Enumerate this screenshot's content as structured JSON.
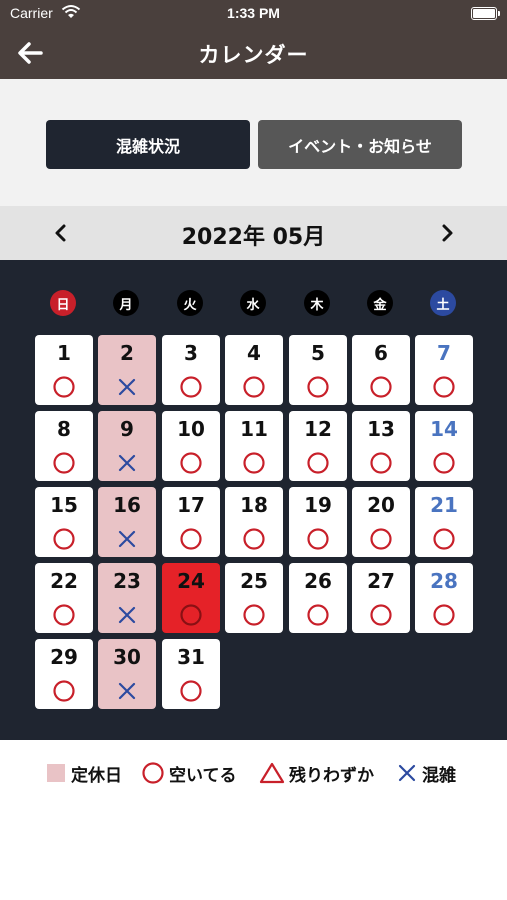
{
  "status": {
    "carrier": "Carrier",
    "time": "1:33 PM"
  },
  "nav": {
    "title": "カレンダー",
    "back_icon": "arrow-left-icon"
  },
  "tabs": {
    "congestion": "混雑状況",
    "events": "イベント・お知らせ"
  },
  "month": {
    "label": "2022年 05月",
    "prev_icon": "chevron-left-icon",
    "next_icon": "chevron-right-icon"
  },
  "weekdays": [
    "日",
    "月",
    "火",
    "水",
    "木",
    "金",
    "土"
  ],
  "calendar": {
    "first_weekday": 0,
    "days": [
      {
        "n": "1",
        "s": "o"
      },
      {
        "n": "2",
        "s": "x",
        "closed": true
      },
      {
        "n": "3",
        "s": "o"
      },
      {
        "n": "4",
        "s": "o"
      },
      {
        "n": "5",
        "s": "o"
      },
      {
        "n": "6",
        "s": "o"
      },
      {
        "n": "7",
        "s": "o"
      },
      {
        "n": "8",
        "s": "o"
      },
      {
        "n": "9",
        "s": "x",
        "closed": true
      },
      {
        "n": "10",
        "s": "o"
      },
      {
        "n": "11",
        "s": "o"
      },
      {
        "n": "12",
        "s": "o"
      },
      {
        "n": "13",
        "s": "o"
      },
      {
        "n": "14",
        "s": "o"
      },
      {
        "n": "15",
        "s": "o"
      },
      {
        "n": "16",
        "s": "x",
        "closed": true
      },
      {
        "n": "17",
        "s": "o"
      },
      {
        "n": "18",
        "s": "o"
      },
      {
        "n": "19",
        "s": "o"
      },
      {
        "n": "20",
        "s": "o"
      },
      {
        "n": "21",
        "s": "o"
      },
      {
        "n": "22",
        "s": "o"
      },
      {
        "n": "23",
        "s": "x",
        "closed": true
      },
      {
        "n": "24",
        "s": "o",
        "today": true
      },
      {
        "n": "25",
        "s": "o"
      },
      {
        "n": "26",
        "s": "o"
      },
      {
        "n": "27",
        "s": "o"
      },
      {
        "n": "28",
        "s": "o"
      },
      {
        "n": "29",
        "s": "o"
      },
      {
        "n": "30",
        "s": "x",
        "closed": true
      },
      {
        "n": "31",
        "s": "o"
      }
    ]
  },
  "legend": {
    "closed": "定休日",
    "available": "空いてる",
    "few_left": "残りわずか",
    "crowded": "混雑"
  },
  "colors": {
    "header_bg": "#4a403d",
    "calendar_bg": "#1f2530",
    "closed_bg": "#e9c3c6",
    "today_bg": "#e52228",
    "circle": "#c8202a",
    "cross": "#2c4aa0",
    "saturday_text": "#4a74c0"
  }
}
